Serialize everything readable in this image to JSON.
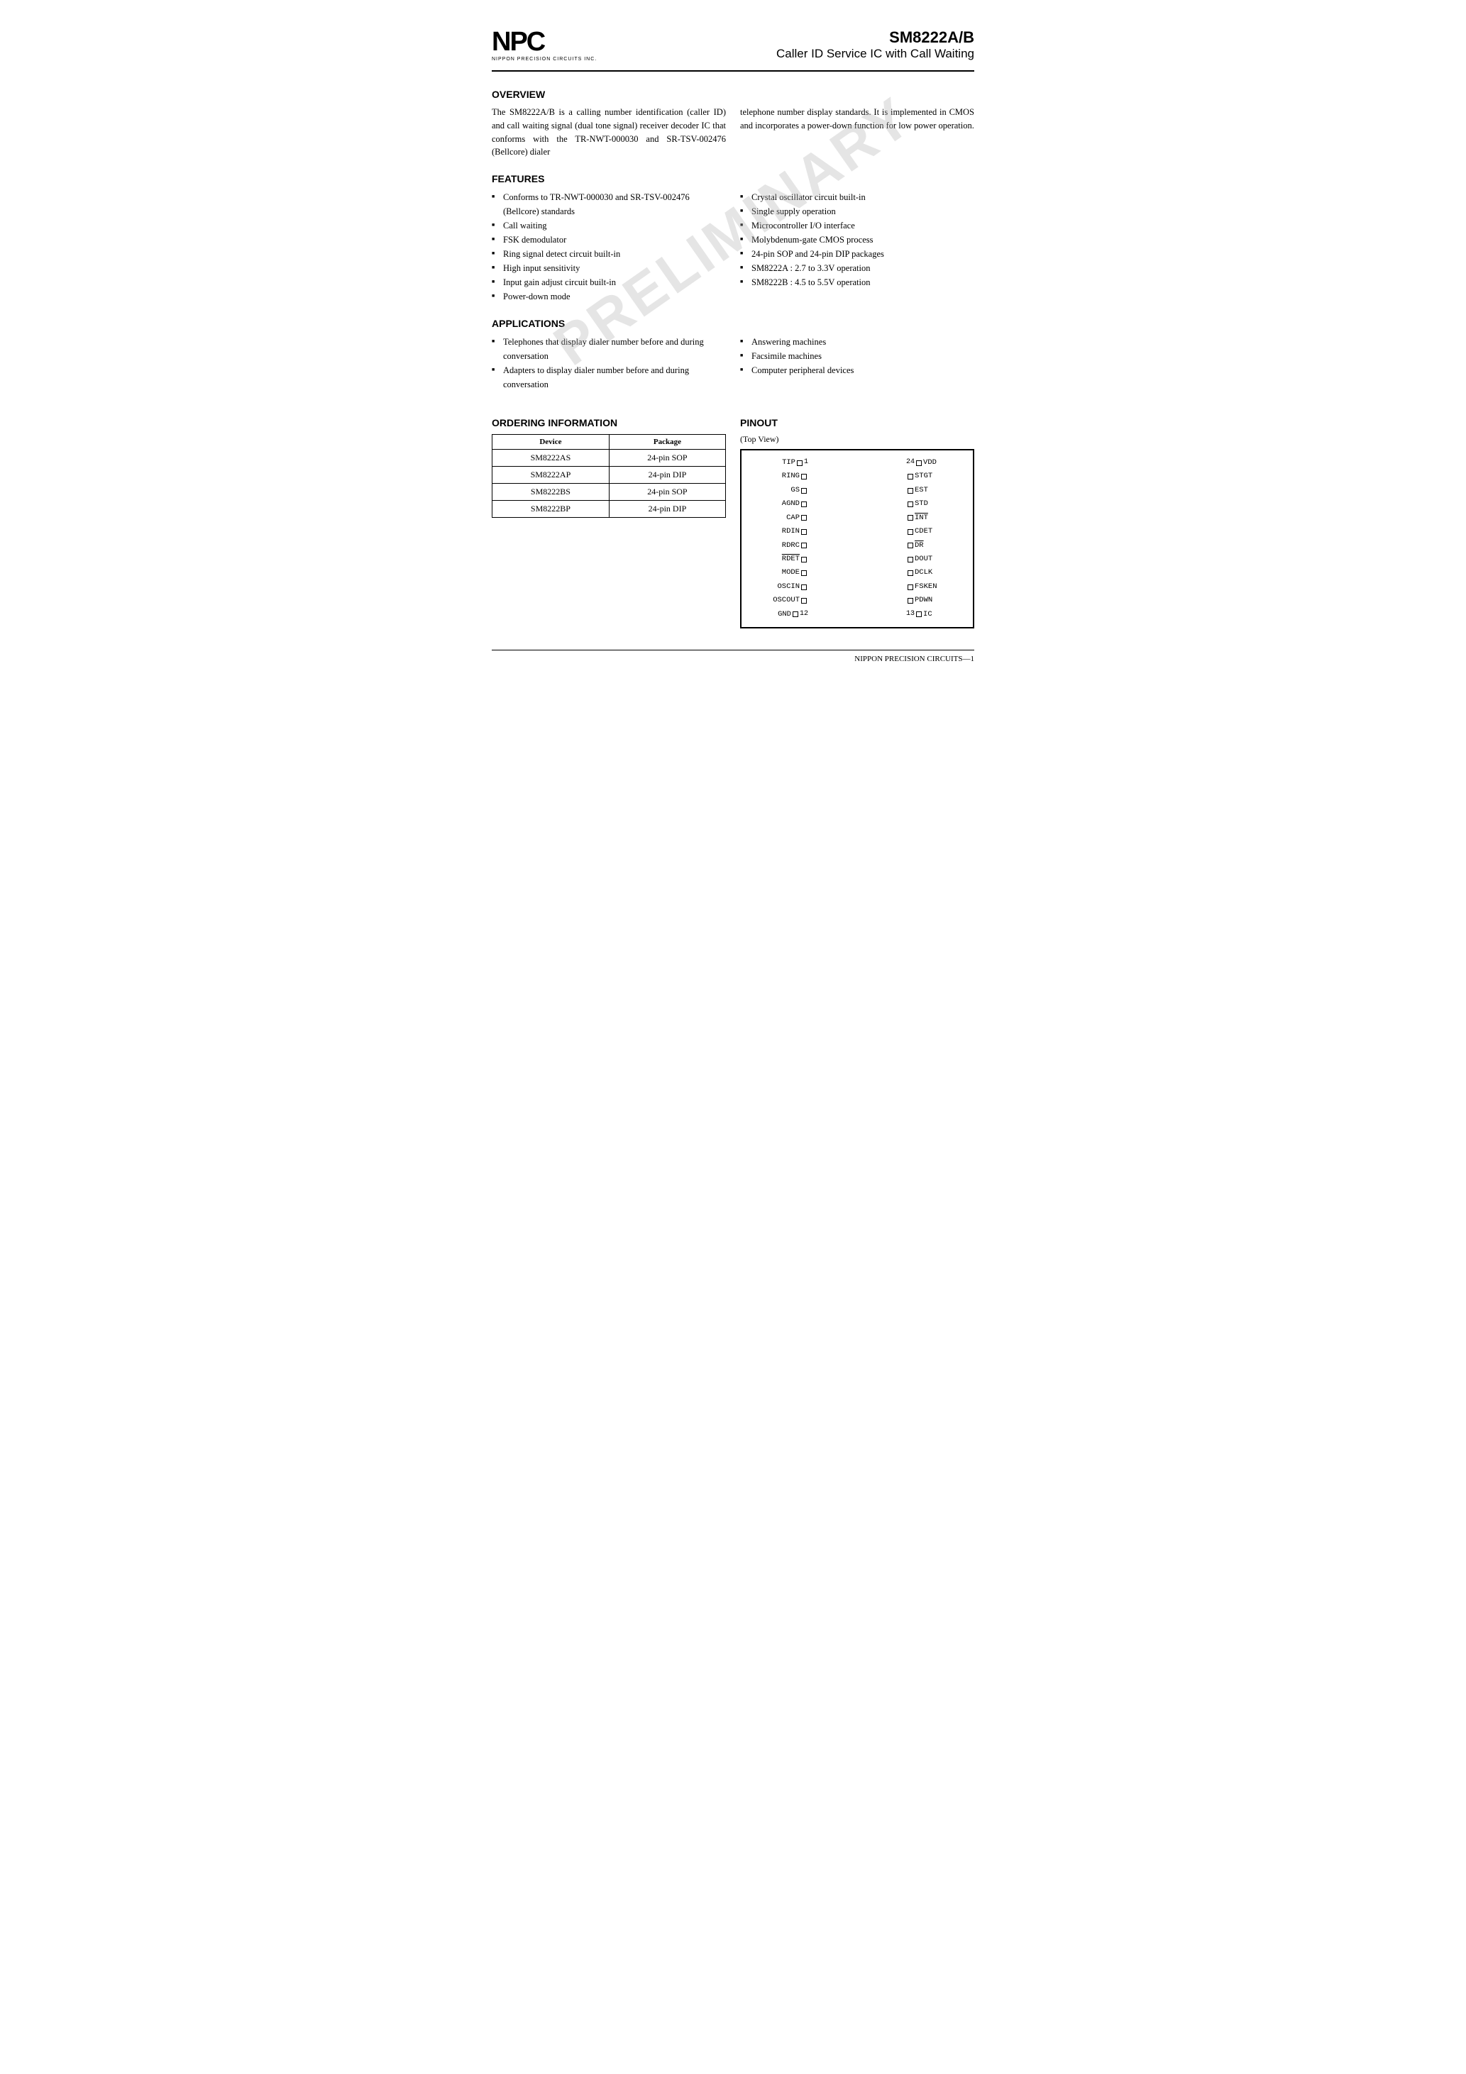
{
  "header": {
    "logo_text": "NPC",
    "logo_subtext": "NIPPON PRECISION CIRCUITS INC.",
    "part_number": "SM8222A/B",
    "part_subtitle": "Caller ID Service IC with Call Waiting"
  },
  "overview": {
    "title": "OVERVIEW",
    "text1": "The SM8222A/B is a calling number identification (caller ID) and call waiting signal (dual tone signal) receiver decoder IC that conforms with the TR-NWT-000030 and SR-TSV-002476 (Bellcore) dialer",
    "text2": "telephone number display standards. It is implemented in CMOS and incorporates a power-down function for low power operation."
  },
  "features": {
    "title": "FEATURES",
    "left": [
      "Conforms to TR-NWT-000030 and SR-TSV-002476 (Bellcore) standards",
      "Call waiting",
      "FSK demodulator",
      "Ring signal detect circuit built-in",
      "High input sensitivity",
      "Input gain adjust circuit built-in",
      "Power-down mode"
    ],
    "right": [
      "Crystal oscillator circuit built-in",
      "Single supply operation",
      "Microcontroller I/O interface",
      "Molybdenum-gate CMOS process",
      "24-pin SOP and 24-pin DIP packages",
      "SM8222A : 2.7 to 3.3V operation",
      "SM8222B : 4.5 to 5.5V operation"
    ]
  },
  "applications": {
    "title": "APPLICATIONS",
    "left": [
      "Telephones that display dialer number before and during conversation",
      "Adapters to display dialer number before and during conversation"
    ],
    "right": [
      "Answering machines",
      "Facsimile machines",
      "Computer peripheral devices"
    ]
  },
  "ordering": {
    "title": "ORDERING INFORMATION",
    "table": {
      "headers": [
        "Device",
        "Package"
      ],
      "rows": [
        [
          "SM8222AS",
          "24-pin SOP"
        ],
        [
          "SM8222AP",
          "24-pin DIP"
        ],
        [
          "SM8222BS",
          "24-pin SOP"
        ],
        [
          "SM8222BP",
          "24-pin DIP"
        ]
      ]
    }
  },
  "pinout": {
    "title": "PINOUT",
    "view_label": "(Top View)",
    "left_pins": [
      {
        "num": "1",
        "name": "TIP"
      },
      {
        "num": "",
        "name": "RING"
      },
      {
        "num": "",
        "name": "GS"
      },
      {
        "num": "",
        "name": "AGND"
      },
      {
        "num": "",
        "name": "CAP"
      },
      {
        "num": "",
        "name": "RDIN"
      },
      {
        "num": "",
        "name": "RDRC"
      },
      {
        "num": "",
        "name": "RDET",
        "overline": true
      },
      {
        "num": "",
        "name": "MODE"
      },
      {
        "num": "",
        "name": "OSCIN"
      },
      {
        "num": "",
        "name": "OSCOUT"
      },
      {
        "num": "12",
        "name": "GND"
      }
    ],
    "right_pins": [
      {
        "num": "24",
        "name": "VDD"
      },
      {
        "num": "",
        "name": "STGT"
      },
      {
        "num": "",
        "name": "EST"
      },
      {
        "num": "",
        "name": "STD"
      },
      {
        "num": "",
        "name": "INT",
        "overline": true
      },
      {
        "num": "",
        "name": "CDET"
      },
      {
        "num": "",
        "name": "DR",
        "overline": true
      },
      {
        "num": "",
        "name": "DOUT"
      },
      {
        "num": "",
        "name": "DCLK"
      },
      {
        "num": "",
        "name": "FSKEN"
      },
      {
        "num": "",
        "name": "PDWN"
      },
      {
        "num": "13",
        "name": "IC"
      }
    ]
  },
  "watermark": "PRELIMINARY",
  "footer": {
    "text": "NIPPON PRECISION CIRCUITS—1"
  }
}
